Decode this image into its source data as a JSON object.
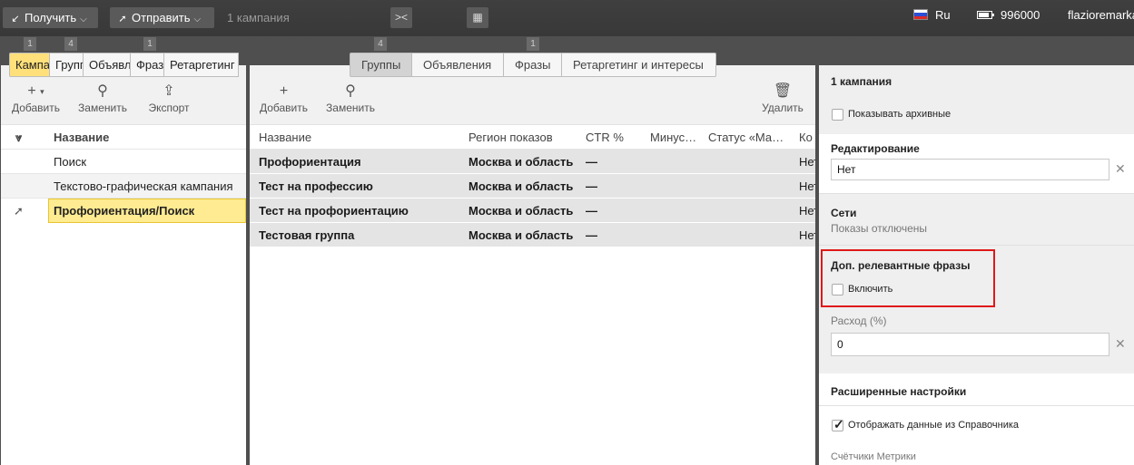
{
  "topbar": {
    "receive_label": "Получить",
    "send_label": "Отправить",
    "campaign_count": "1 кампания",
    "language": "Ru",
    "balance": "996000",
    "user": "flazioremarka"
  },
  "badges": {
    "campaigns": "1",
    "groups": "4",
    "phrases": "1",
    "mid_groups": "4",
    "mid_phrases": "1"
  },
  "left_tabs": [
    {
      "label": "Кампании",
      "active": true
    },
    {
      "label": "Группы"
    },
    {
      "label": "Объявления"
    },
    {
      "label": "Фразы"
    },
    {
      "label": "Ретаргетинг"
    }
  ],
  "mid_tabs": [
    {
      "label": "Группы",
      "active": true
    },
    {
      "label": "Объявления"
    },
    {
      "label": "Фразы"
    },
    {
      "label": "Ретаргетинг и интересы"
    }
  ],
  "left_toolbar": {
    "add": "Добавить",
    "replace": "Заменить",
    "export": "Экспорт"
  },
  "left_list": {
    "header": "Название",
    "rows": [
      "Поиск",
      "Текстово-графическая кампания",
      "Профориентация/Поиск"
    ]
  },
  "mid_toolbar": {
    "add": "Добавить",
    "replace": "Заменить",
    "delete": "Удалить"
  },
  "mid_table": {
    "columns": [
      "Название",
      "Регион показов",
      "CTR  %",
      "Минус-фразы",
      "Статус «Мало показов»",
      "Ко"
    ],
    "rows": [
      {
        "name": "Профориентация",
        "region": "Москва и область",
        "ctr": "—",
        "minus": "",
        "status": "",
        "extra": "Нет"
      },
      {
        "name": "Тест на профессию",
        "region": "Москва и область",
        "ctr": "—",
        "minus": "",
        "status": "",
        "extra": "Нет"
      },
      {
        "name": "Тест на профориентацию",
        "region": "Москва и область",
        "ctr": "—",
        "minus": "",
        "status": "",
        "extra": "Нет"
      },
      {
        "name": "Тестовая группа",
        "region": "Москва и область",
        "ctr": "—",
        "minus": "",
        "status": "",
        "extra": "Нет"
      }
    ]
  },
  "right_panel": {
    "title": "1 кампания",
    "show_archived": "Показывать архивные",
    "editing_header": "Редактирование",
    "editing_value": "Нет",
    "networks_header": "Сети",
    "networks_value": "Показы отключены",
    "extra_phrases_header": "Доп. релевантные фразы",
    "enable_label": "Включить",
    "spend_label": "Расход (%)",
    "spend_value": "0",
    "advanced_header": "Расширенные настройки",
    "directory_label": "Отображать данные из Справочника",
    "metrika_label": "Счётчики Метрики"
  }
}
